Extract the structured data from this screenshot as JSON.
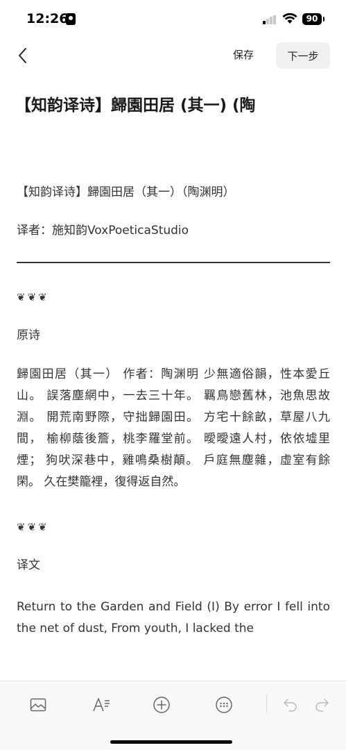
{
  "status": {
    "time": "12:26",
    "battery": "90"
  },
  "nav": {
    "save_label": "保存",
    "next_label": "下一步"
  },
  "doc": {
    "title": "【知韵译诗】歸園田居 (其一) (陶",
    "subtitle": "【知韵译诗】歸園田居（其一）（陶渊明）",
    "translator": "译者：施知韵VoxPoeticaStudio",
    "ornament_1": "❦❦❦",
    "section_original": "原诗",
    "poem": "歸園田居（其一） 作者：陶渊明 少無適俗韻，性本愛丘山。 誤落塵網中，一去三十年。 羈鳥戀舊林，池魚思故淵。 開荒南野際，守拙歸園田。 方宅十餘畝，草屋八九間， 榆柳蔭後簷，桃李羅堂前。 曖曖遠人村，依依墟里煙； 狗吠深巷中，雞鳴桑樹顛。 戶庭無塵雜，虛室有餘閑。 久在樊籠裡，復得返自然。",
    "ornament_2": "❦❦❦",
    "section_translation": "译文",
    "translation": "Return to the Garden and Field (I) By error I fell into the net of dust, From youth, I lacked the"
  },
  "toolbar": {
    "items": [
      "image-icon",
      "text-format-icon",
      "add-icon",
      "more-icon",
      "undo-icon",
      "redo-icon"
    ]
  }
}
